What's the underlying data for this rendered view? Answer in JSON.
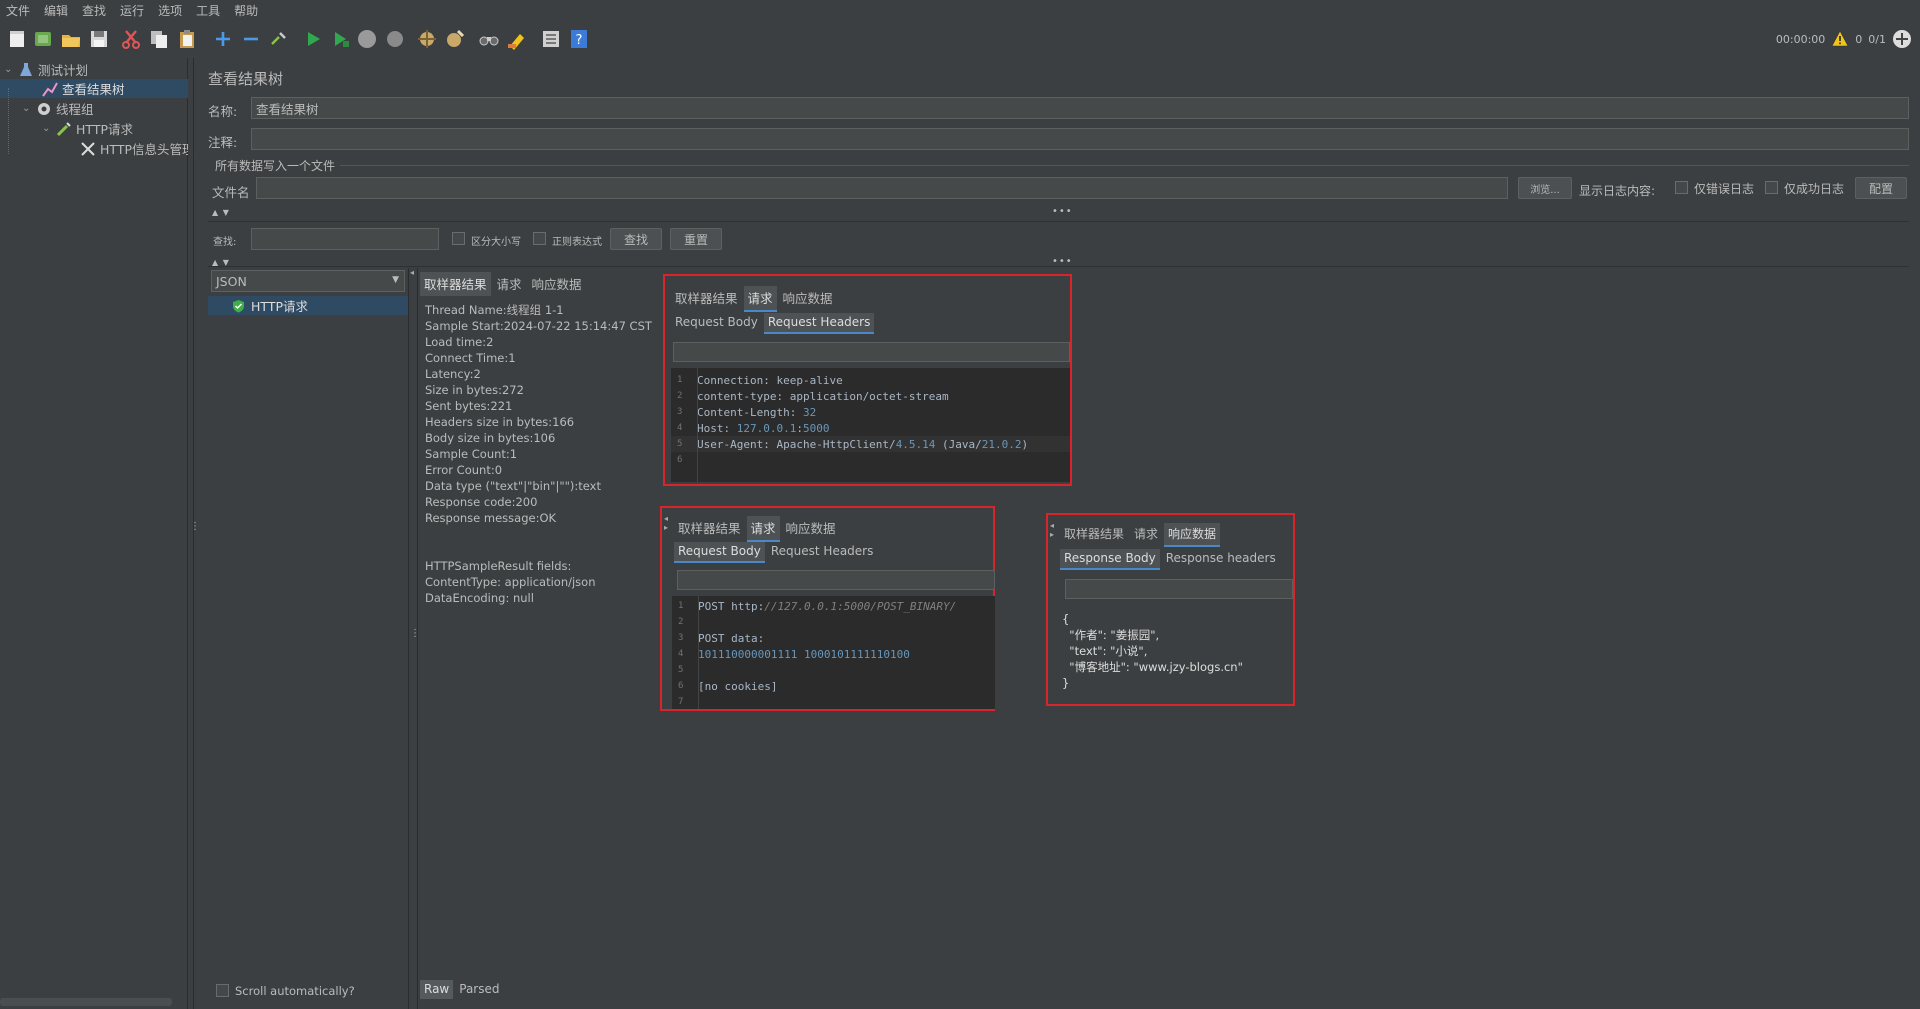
{
  "menu": [
    "文件",
    "编辑",
    "查找",
    "运行",
    "选项",
    "工具",
    "帮助"
  ],
  "toolbar": {
    "icons": [
      "new-icon",
      "templates-icon",
      "open-icon",
      "save-icon",
      "save-as-icon",
      "cut-icon",
      "copy-icon",
      "paste-icon",
      "expand-icon",
      "collapse-icon",
      "toggle-icon",
      "start-icon",
      "start-no-pause-icon",
      "stop-icon",
      "shutdown-icon",
      "clear-icon",
      "clear-all-icon",
      "search-binoculars-icon",
      "reset-search-icon",
      "function-helper-icon",
      "help-icon"
    ],
    "timer": "00:00:00",
    "warnings": "0",
    "threads": "0/1"
  },
  "tree": [
    {
      "label": "测试计划",
      "icon": "flask-icon",
      "level": 0,
      "expanded": true,
      "selected": false
    },
    {
      "label": "查看结果树",
      "icon": "chart-icon",
      "level": 1,
      "expanded": false,
      "selected": true
    },
    {
      "label": "线程组",
      "icon": "gear-icon",
      "level": 1,
      "expanded": true,
      "selected": false
    },
    {
      "label": "HTTP请求",
      "icon": "pipette-icon",
      "level": 2,
      "expanded": true,
      "selected": false
    },
    {
      "label": "HTTP信息头管理",
      "icon": "wrench-icon",
      "level": 3,
      "expanded": false,
      "selected": false
    }
  ],
  "panel": {
    "title": "查看结果树",
    "name_label": "名称:",
    "name_value": "查看结果树",
    "comment_label": "注释:",
    "comment_value": "",
    "file_section": "所有数据写入一个文件",
    "filename_label": "文件名",
    "filename_value": "",
    "browse_button": "浏览...",
    "log_label": "显示日志内容:",
    "errors_only": "仅错误日志",
    "success_only": "仅成功日志",
    "config_button": "配置",
    "search_label": "查找:",
    "case_sensitive": "区分大小写",
    "regex": "正则表达式",
    "find_button": "查找",
    "reset_button": "重置"
  },
  "results": {
    "renderer": "JSON",
    "items": [
      "HTTP请求"
    ],
    "scroll_auto": "Scroll automatically?",
    "tabs": [
      "取样器结果",
      "请求",
      "响应数据"
    ],
    "active_tab": 0,
    "sampler_lines": [
      "Thread Name:线程组 1-1",
      "Sample Start:2024-07-22 15:14:47 CST",
      "Load time:2",
      "Connect Time:1",
      "Latency:2",
      "Size in bytes:272",
      "Sent bytes:221",
      "Headers size in bytes:166",
      "Body size in bytes:106",
      "Sample Count:1",
      "Error Count:0",
      "Data type (\"text\"|\"bin\"|\"\"):text",
      "Response code:200",
      "Response message:OK",
      "",
      "",
      "HTTPSampleResult fields:",
      "ContentType: application/json",
      "DataEncoding: null"
    ],
    "bottom_tabs": [
      "Raw",
      "Parsed"
    ]
  },
  "popup1": {
    "tabs": [
      "取样器结果",
      "请求",
      "响应数据"
    ],
    "subtabs": [
      "Request Body",
      "Request Headers"
    ],
    "lines": [
      [
        "Connection: keep-alive"
      ],
      [
        "content-type: application/octet-stream"
      ],
      [
        "Content-Length: ",
        "32"
      ],
      [
        "Host: ",
        "127.0.0.1",
        ":",
        "5000"
      ],
      [
        "User-Agent: Apache-HttpClient/",
        "4.5.14",
        " (Java/",
        "21.0.2",
        ")"
      ],
      [
        ""
      ]
    ],
    "gutter": [
      "1",
      "2",
      "3",
      "4",
      "5",
      "6"
    ]
  },
  "popup2": {
    "tabs": [
      "取样器结果",
      "请求",
      "响应数据"
    ],
    "subtabs": [
      "Request Body",
      "Request Headers"
    ],
    "line1_prefix": "POST http:",
    "line1_url": "//127.0.0.1:5000/POST_BINARY/",
    "line3": "POST data:",
    "line4": "101110000001111 1000101111110100",
    "line6": "[no cookies]",
    "gutter": [
      "1",
      "2",
      "3",
      "4",
      "5",
      "6",
      "7"
    ]
  },
  "popup3": {
    "tabs": [
      "取样器结果",
      "请求",
      "响应数据"
    ],
    "subtabs": [
      "Response Body",
      "Response headers"
    ],
    "json_lines": [
      "{",
      "  \"作者\": \"姜振园\",",
      "  \"text\": \"小说\",",
      "  \"博客地址\": \"www.jzy-blogs.cn\"",
      "}"
    ]
  }
}
